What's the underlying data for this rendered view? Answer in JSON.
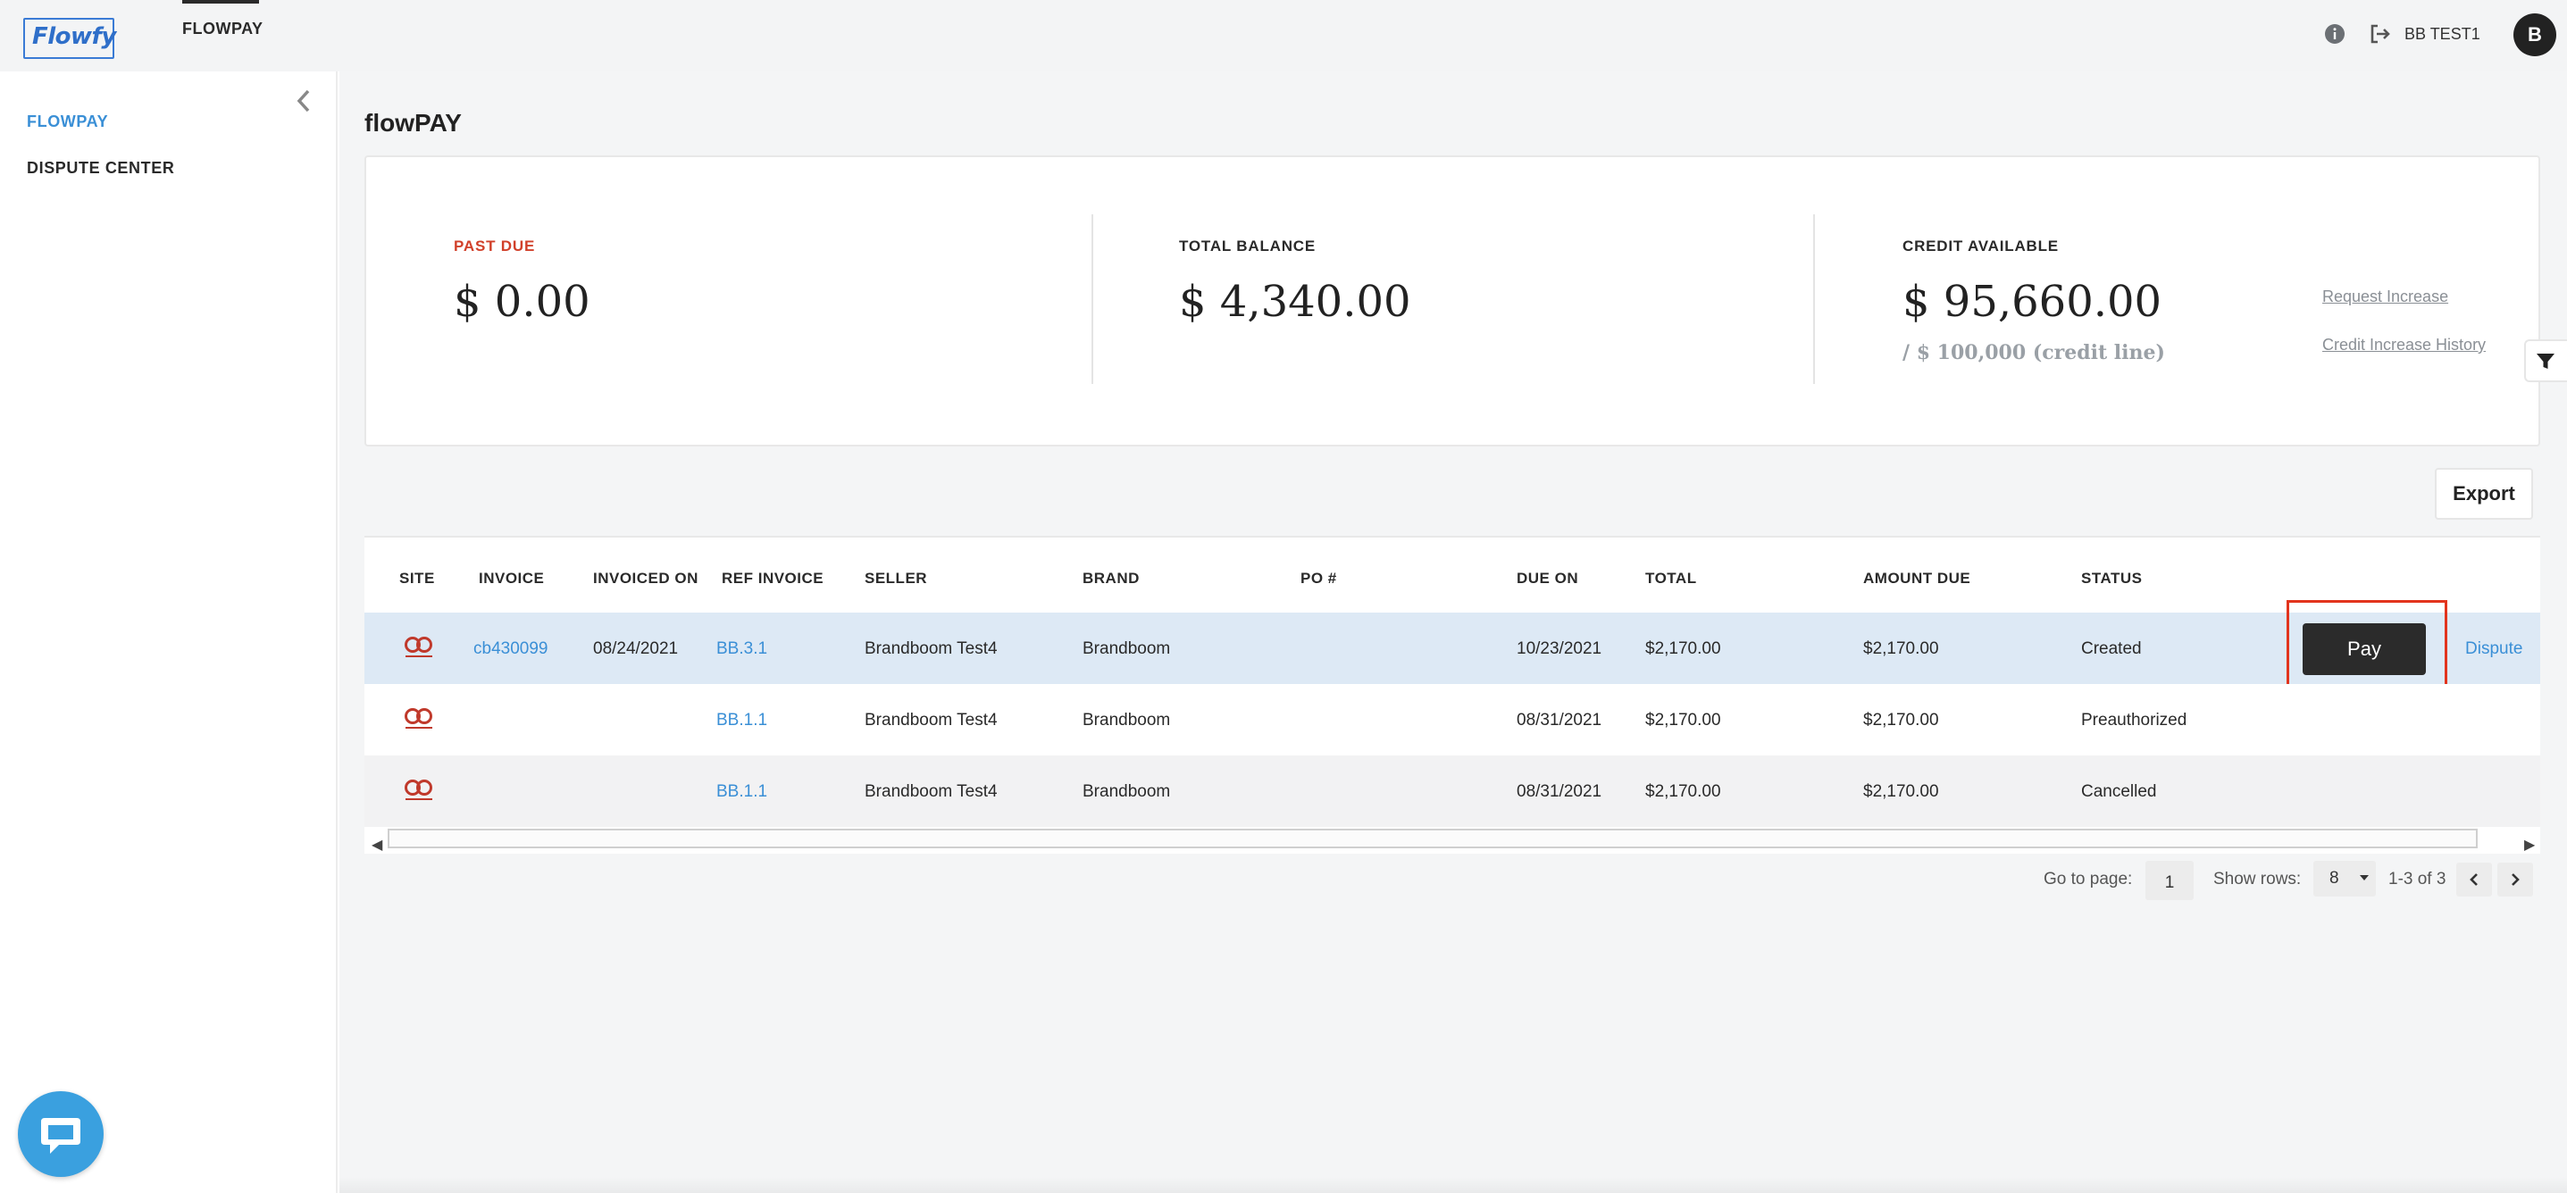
{
  "topbar": {
    "logo_text": "Flowfy",
    "nav_tab": "FLOWPAY",
    "user_name": "BB TEST1",
    "avatar_letter": "B"
  },
  "sidebar": {
    "items": [
      {
        "label": "FLOWPAY"
      },
      {
        "label": "DISPUTE CENTER"
      }
    ]
  },
  "main": {
    "title": "flowPAY",
    "summary": {
      "past_due_label": "PAST DUE",
      "past_due_value": "$ 0.00",
      "total_balance_label": "TOTAL BALANCE",
      "total_balance_value": "$ 4,340.00",
      "credit_available_label": "CREDIT AVAILABLE",
      "credit_available_value": "$ 95,660.00",
      "credit_line": "/ $ 100,000 (credit line)",
      "request_increase": "Request Increase",
      "credit_history": "Credit Increase History"
    },
    "export_label": "Export",
    "table": {
      "headers": [
        "SITE",
        "INVOICE",
        "INVOICED ON",
        "REF INVOICE",
        "SELLER",
        "BRAND",
        "PO #",
        "DUE ON",
        "TOTAL",
        "AMOUNT DUE",
        "STATUS"
      ],
      "rows": [
        {
          "invoice": "cb430099",
          "invoiced_on": "08/24/2021",
          "ref_invoice": "BB.3.1",
          "seller": "Brandboom Test4",
          "brand": "Brandboom",
          "po": "",
          "due_on": "10/23/2021",
          "total": "$2,170.00",
          "amount_due": "$2,170.00",
          "status": "Created"
        },
        {
          "invoice": "",
          "invoiced_on": "",
          "ref_invoice": "BB.1.1",
          "seller": "Brandboom Test4",
          "brand": "Brandboom",
          "po": "",
          "due_on": "08/31/2021",
          "total": "$2,170.00",
          "amount_due": "$2,170.00",
          "status": "Preauthorized"
        },
        {
          "invoice": "",
          "invoiced_on": "",
          "ref_invoice": "BB.1.1",
          "seller": "Brandboom Test4",
          "brand": "Brandboom",
          "po": "",
          "due_on": "08/31/2021",
          "total": "$2,170.00",
          "amount_due": "$2,170.00",
          "status": "Cancelled"
        }
      ],
      "pay_label": "Pay",
      "dispute_label": "Dispute"
    },
    "pagination": {
      "go_to_label": "Go to page:",
      "page_value": "1",
      "show_rows_label": "Show rows:",
      "rows_value": "8",
      "range_text": "1-3 of 3"
    }
  },
  "colors": {
    "accent_blue": "#3a8fd6",
    "past_due_red": "#d1402a",
    "highlight_red": "#e2341d",
    "selected_row": "#dde9f5"
  },
  "icons": [
    "info-icon",
    "logout-icon",
    "chevron-left-icon",
    "filter-icon",
    "site-logo-icon",
    "chat-icon",
    "chevron-right-icon"
  ]
}
